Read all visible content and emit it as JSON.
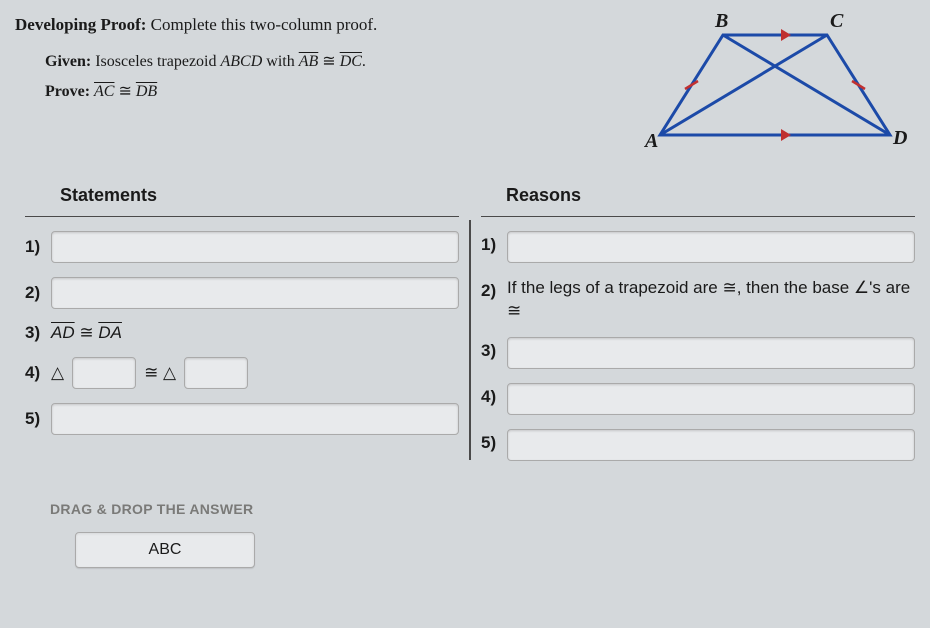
{
  "prompt": {
    "titleBold": "Developing Proof:",
    "titleRest": " Complete this two-column proof.",
    "givenLabel": "Given:",
    "givenText": " Isosceles trapezoid ",
    "givenShape": "ABCD",
    "givenWith": " with ",
    "givenSeg1": "AB",
    "congr": " ≅ ",
    "givenSeg2": "DC",
    "period": ".",
    "proveLabel": "Prove:",
    "proveSeg1": "AC",
    "proveSeg2": "DB"
  },
  "diagram": {
    "labels": {
      "A": "A",
      "B": "B",
      "C": "C",
      "D": "D"
    }
  },
  "columns": {
    "statements": "Statements",
    "reasons": "Reasons"
  },
  "rows": {
    "n1": "1)",
    "n2": "2)",
    "n3": "3)",
    "n4": "4)",
    "n5": "5)",
    "s3a": "AD",
    "s3cong": " ≅  ",
    "s3b": "DA",
    "s4a": "△",
    "s4cong": " ≅ △",
    "r2": "If the legs of a trapezoid are ≅, then the base ∠'s are ≅"
  },
  "dragdrop": {
    "label": "DRAG & DROP THE ANSWER",
    "tile1": "ABC"
  }
}
